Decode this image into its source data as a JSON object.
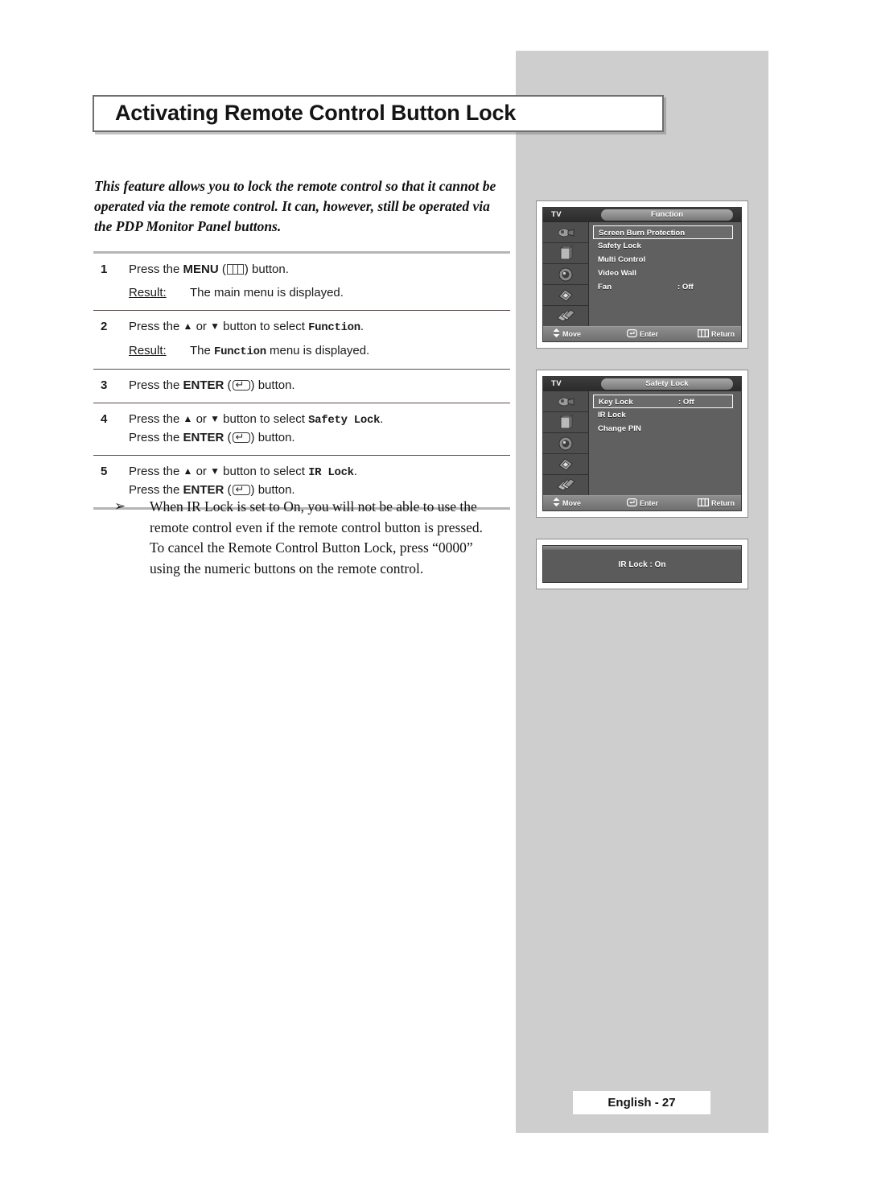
{
  "page": {
    "title": "Activating Remote Control Button Lock",
    "footer_label": "English - 27",
    "intro": "This feature allows you to lock the remote control so that it cannot be operated via the remote control. It can, however, still be operated via the PDP Monitor Panel buttons."
  },
  "steps": [
    {
      "number": "1",
      "lead": "Press the ",
      "key": "MENU",
      "icon": "menu-icon",
      "tail": " button.",
      "result_label": "Result:",
      "result_text": "The main menu is displayed."
    },
    {
      "number": "2",
      "lead": "Press the ",
      "mid": " or ",
      "mid2": " button to select ",
      "target": "Function",
      "tail": ".",
      "result_label": "Result:",
      "result_pre": "The ",
      "result_mono": "Function",
      "result_post": " menu is displayed."
    },
    {
      "number": "3",
      "lead": "Press the ",
      "key": "ENTER",
      "icon": "enter-icon",
      "tail": " button."
    },
    {
      "number": "4",
      "lead": "Press the ",
      "mid": " or ",
      "mid2": " button to select ",
      "target": "Safety Lock",
      "tail": ".",
      "line2_lead": "Press the ",
      "line2_key": "ENTER",
      "line2_tail": " button."
    },
    {
      "number": "5",
      "lead": "Press the ",
      "mid": " or ",
      "mid2": " button to select ",
      "target": "IR Lock",
      "tail": ".",
      "line2_lead": "Press the ",
      "line2_key": "ENTER",
      "line2_tail": " button."
    }
  ],
  "note": {
    "bullet": "➢",
    "line1": "When IR Lock is set to On, you will not be able to use the",
    "line2": "remote control even if the remote control button is pressed.",
    "line3": "To cancel the Remote Control Button Lock, press “0000”",
    "line4": "using the numeric buttons on the remote control."
  },
  "osd_common": {
    "source_label": "TV",
    "footer": {
      "move": "Move",
      "enter": "Enter",
      "return": "Return"
    }
  },
  "osd1": {
    "title": "Function",
    "items": [
      {
        "label": "Screen Burn Protection",
        "value": "",
        "selected": true
      },
      {
        "label": "Safety Lock",
        "value": "",
        "selected": false
      },
      {
        "label": "Multi Control",
        "value": "",
        "selected": false
      },
      {
        "label": "Video Wall",
        "value": "",
        "selected": false
      },
      {
        "label": "Fan",
        "value": ": Off",
        "selected": false
      }
    ]
  },
  "osd2": {
    "title": "Safety Lock",
    "items": [
      {
        "label": "Key Lock",
        "value": ": Off",
        "selected": true
      },
      {
        "label": "IR Lock",
        "value": "",
        "selected": false
      },
      {
        "label": "Change PIN",
        "value": "",
        "selected": false
      }
    ]
  },
  "osd3": {
    "message": "IR Lock : On"
  },
  "colors": {
    "panel_gray": "#cecece",
    "osd_body": "#606060",
    "osd_header": "#2b2b2b",
    "rule": "#5d4a4a"
  }
}
